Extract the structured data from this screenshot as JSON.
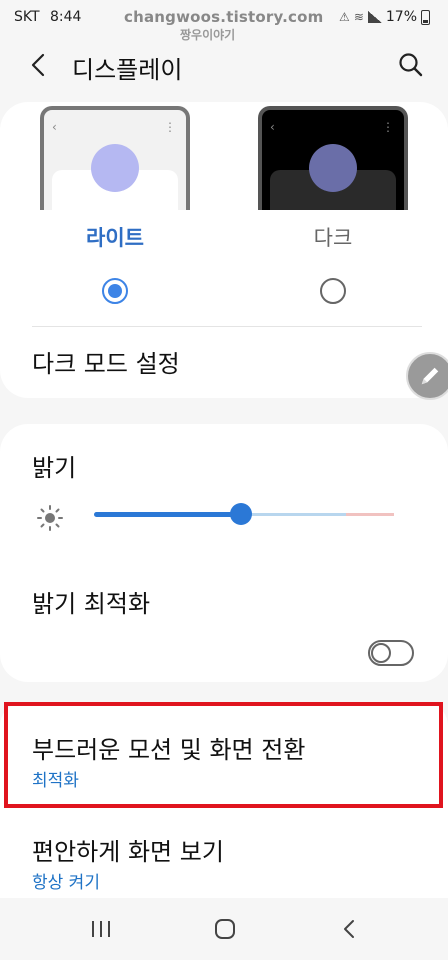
{
  "status": {
    "carrier": "SKT",
    "time": "8:44",
    "watermark": "changwoos.tistory.com",
    "watermark_sub": "짱우이야기",
    "battery": "17%"
  },
  "header": {
    "title": "디스플레이"
  },
  "theme": {
    "light_label": "라이트",
    "dark_label": "다크",
    "selected": "light",
    "dark_mode_settings": "다크 모드 설정"
  },
  "brightness": {
    "label": "밝기",
    "level": 0.49,
    "adaptive_label": "밝기 최적화",
    "adaptive_on": false
  },
  "motion": {
    "label": "부드러운 모션 및 화면 전환",
    "value": "최적화"
  },
  "eye_comfort": {
    "label": "편안하게 화면 보기",
    "value": "항상 켜기"
  },
  "colors": {
    "accent": "#2b78d6",
    "highlight": "#e0141e",
    "subtext": "#1f73c6"
  },
  "icons": [
    "back-icon",
    "search-icon",
    "edit-icon",
    "sun-icon",
    "recents-icon",
    "home-icon",
    "nav-back-icon"
  ]
}
